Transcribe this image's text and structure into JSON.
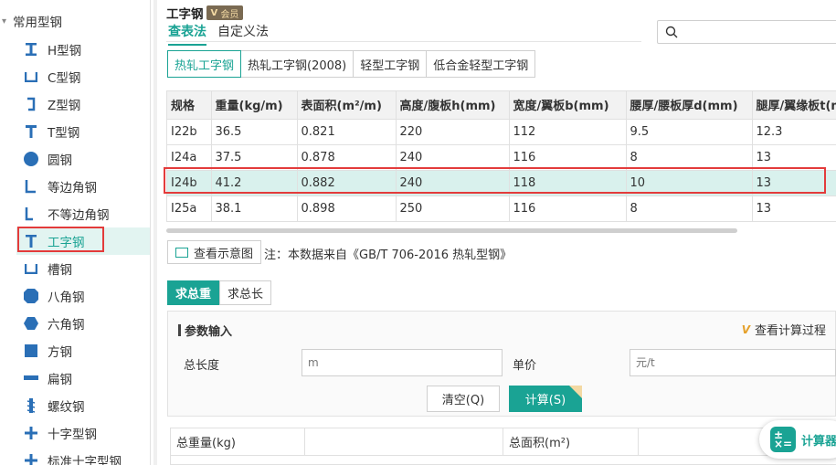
{
  "sidebar": {
    "group_label": "常用型钢",
    "items": [
      {
        "label": "H型钢",
        "icon": "h-beam-icon",
        "vip": false
      },
      {
        "label": "C型钢",
        "icon": "c-channel-icon",
        "vip": false
      },
      {
        "label": "Z型钢",
        "icon": "z-section-icon",
        "vip": false
      },
      {
        "label": "T型钢",
        "icon": "t-section-icon",
        "vip": false
      },
      {
        "label": "圆钢",
        "icon": "round-bar-icon",
        "vip": true
      },
      {
        "label": "等边角钢",
        "icon": "equal-angle-icon",
        "vip": true
      },
      {
        "label": "不等边角钢",
        "icon": "unequal-angle-icon",
        "vip": true
      },
      {
        "label": "工字钢",
        "icon": "i-beam-icon",
        "vip": true,
        "active": true
      },
      {
        "label": "槽钢",
        "icon": "channel-icon",
        "vip": true
      },
      {
        "label": "八角钢",
        "icon": "octagon-bar-icon",
        "vip": true
      },
      {
        "label": "六角钢",
        "icon": "hexagon-bar-icon",
        "vip": true
      },
      {
        "label": "方钢",
        "icon": "square-bar-icon",
        "vip": true
      },
      {
        "label": "扁钢",
        "icon": "flat-bar-icon",
        "vip": true
      },
      {
        "label": "螺纹钢",
        "icon": "rebar-icon",
        "vip": true
      },
      {
        "label": "十字型钢",
        "icon": "cross-section-icon",
        "vip": true
      },
      {
        "label": "标准十字型钢",
        "icon": "standard-cross-icon",
        "vip": true
      }
    ]
  },
  "header": {
    "title": "工字钢",
    "vip_badge": "会员",
    "vip_badge_mark": "V",
    "mode_tabs": [
      "查表法",
      "自定义法"
    ],
    "active_mode": 0,
    "search_placeholder": ""
  },
  "std_tabs": [
    "热轧工字钢",
    "热轧工字钢(2008)",
    "轻型工字钢",
    "低合金轻型工字钢"
  ],
  "active_std_tab": 0,
  "table": {
    "columns": [
      "规格",
      "重量(kg/m)",
      "表面积(m²/m)",
      "高度/腹板h(mm)",
      "宽度/翼板b(mm)",
      "腰厚/腰板厚d(mm)",
      "腿厚/翼缘板t(mm)"
    ],
    "rows": [
      [
        "I22b",
        "36.5",
        "0.821",
        "220",
        "112",
        "9.5",
        "12.3"
      ],
      [
        "I24a",
        "37.5",
        "0.878",
        "240",
        "116",
        "8",
        "13"
      ],
      [
        "I24b",
        "41.2",
        "0.882",
        "240",
        "118",
        "10",
        "13"
      ],
      [
        "I25a",
        "38.1",
        "0.898",
        "250",
        "116",
        "8",
        "13"
      ]
    ],
    "selected_row": 2
  },
  "view_diagram_label": "查看示意图",
  "data_note": "注：本数据来自《GB/T 706-2016 热轧型钢》",
  "calc_tabs": [
    "求总重",
    "求总长"
  ],
  "active_calc_tab": 0,
  "params": {
    "title": "参数输入",
    "process_label": "查看计算过程",
    "process_mark": "V",
    "length_label": "总长度",
    "length_placeholder": "m",
    "price_label": "单价",
    "price_placeholder": "元/t",
    "clear_label": "清空(Q)",
    "calc_label": "计算(S)"
  },
  "results": {
    "total_weight_label": "总重量(kg)",
    "total_area_label": "总面积(m²)"
  },
  "fab": {
    "label": "计算器"
  },
  "colors": {
    "accent": "#1aa394",
    "highlight": "#e33b3b",
    "vip_gold": "#e5a12b"
  }
}
